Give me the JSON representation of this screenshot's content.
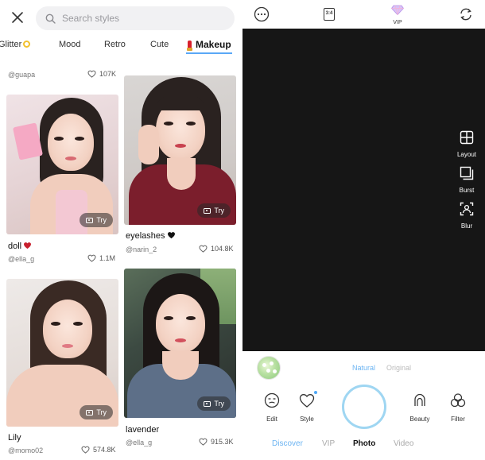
{
  "left": {
    "search": {
      "placeholder": "Search styles"
    },
    "tabs": [
      {
        "label": "Glitter"
      },
      {
        "label": "Mood"
      },
      {
        "label": "Retro"
      },
      {
        "label": "Cute"
      },
      {
        "label": "Makeup",
        "active": true
      }
    ],
    "top_row": {
      "author": "@guapa",
      "likes": "107K"
    },
    "cards": [
      {
        "title": "doll",
        "title_emoji": "heart-red",
        "author": "@ella_g",
        "likes": "1.1M",
        "try_label": "Try"
      },
      {
        "title": "eyelashes",
        "title_emoji": "heart-black",
        "author": "@narin_2",
        "likes": "104.8K",
        "try_label": "Try"
      },
      {
        "title": "Lily",
        "author": "@momo02",
        "likes": "574.8K",
        "try_label": "Try"
      },
      {
        "title": "lavender",
        "author": "@ella_g",
        "likes": "915.3K",
        "try_label": "Try"
      }
    ]
  },
  "right": {
    "top": {
      "ratio_label": "3:4",
      "vip_label": "VIP"
    },
    "side_tools": [
      {
        "icon": "layout-icon",
        "label": "Layout"
      },
      {
        "icon": "burst-icon",
        "label": "Burst"
      },
      {
        "icon": "blur-icon",
        "label": "Blur"
      }
    ],
    "modes": {
      "natural": "Natural",
      "original": "Original",
      "active": "Natural"
    },
    "tools": [
      {
        "icon": "edit-icon",
        "label": "Edit"
      },
      {
        "icon": "style-icon",
        "label": "Style"
      },
      {
        "icon": "beauty-icon",
        "label": "Beauty"
      },
      {
        "icon": "filter-icon",
        "label": "Filter"
      }
    ],
    "nav": [
      {
        "label": "Discover"
      },
      {
        "label": "VIP"
      },
      {
        "label": "Photo",
        "active": true
      },
      {
        "label": "Video"
      }
    ]
  },
  "colors": {
    "accent_blue": "#5aa8f7",
    "shutter_ring": "#9fd6f2",
    "viewfinder": "#161616"
  }
}
